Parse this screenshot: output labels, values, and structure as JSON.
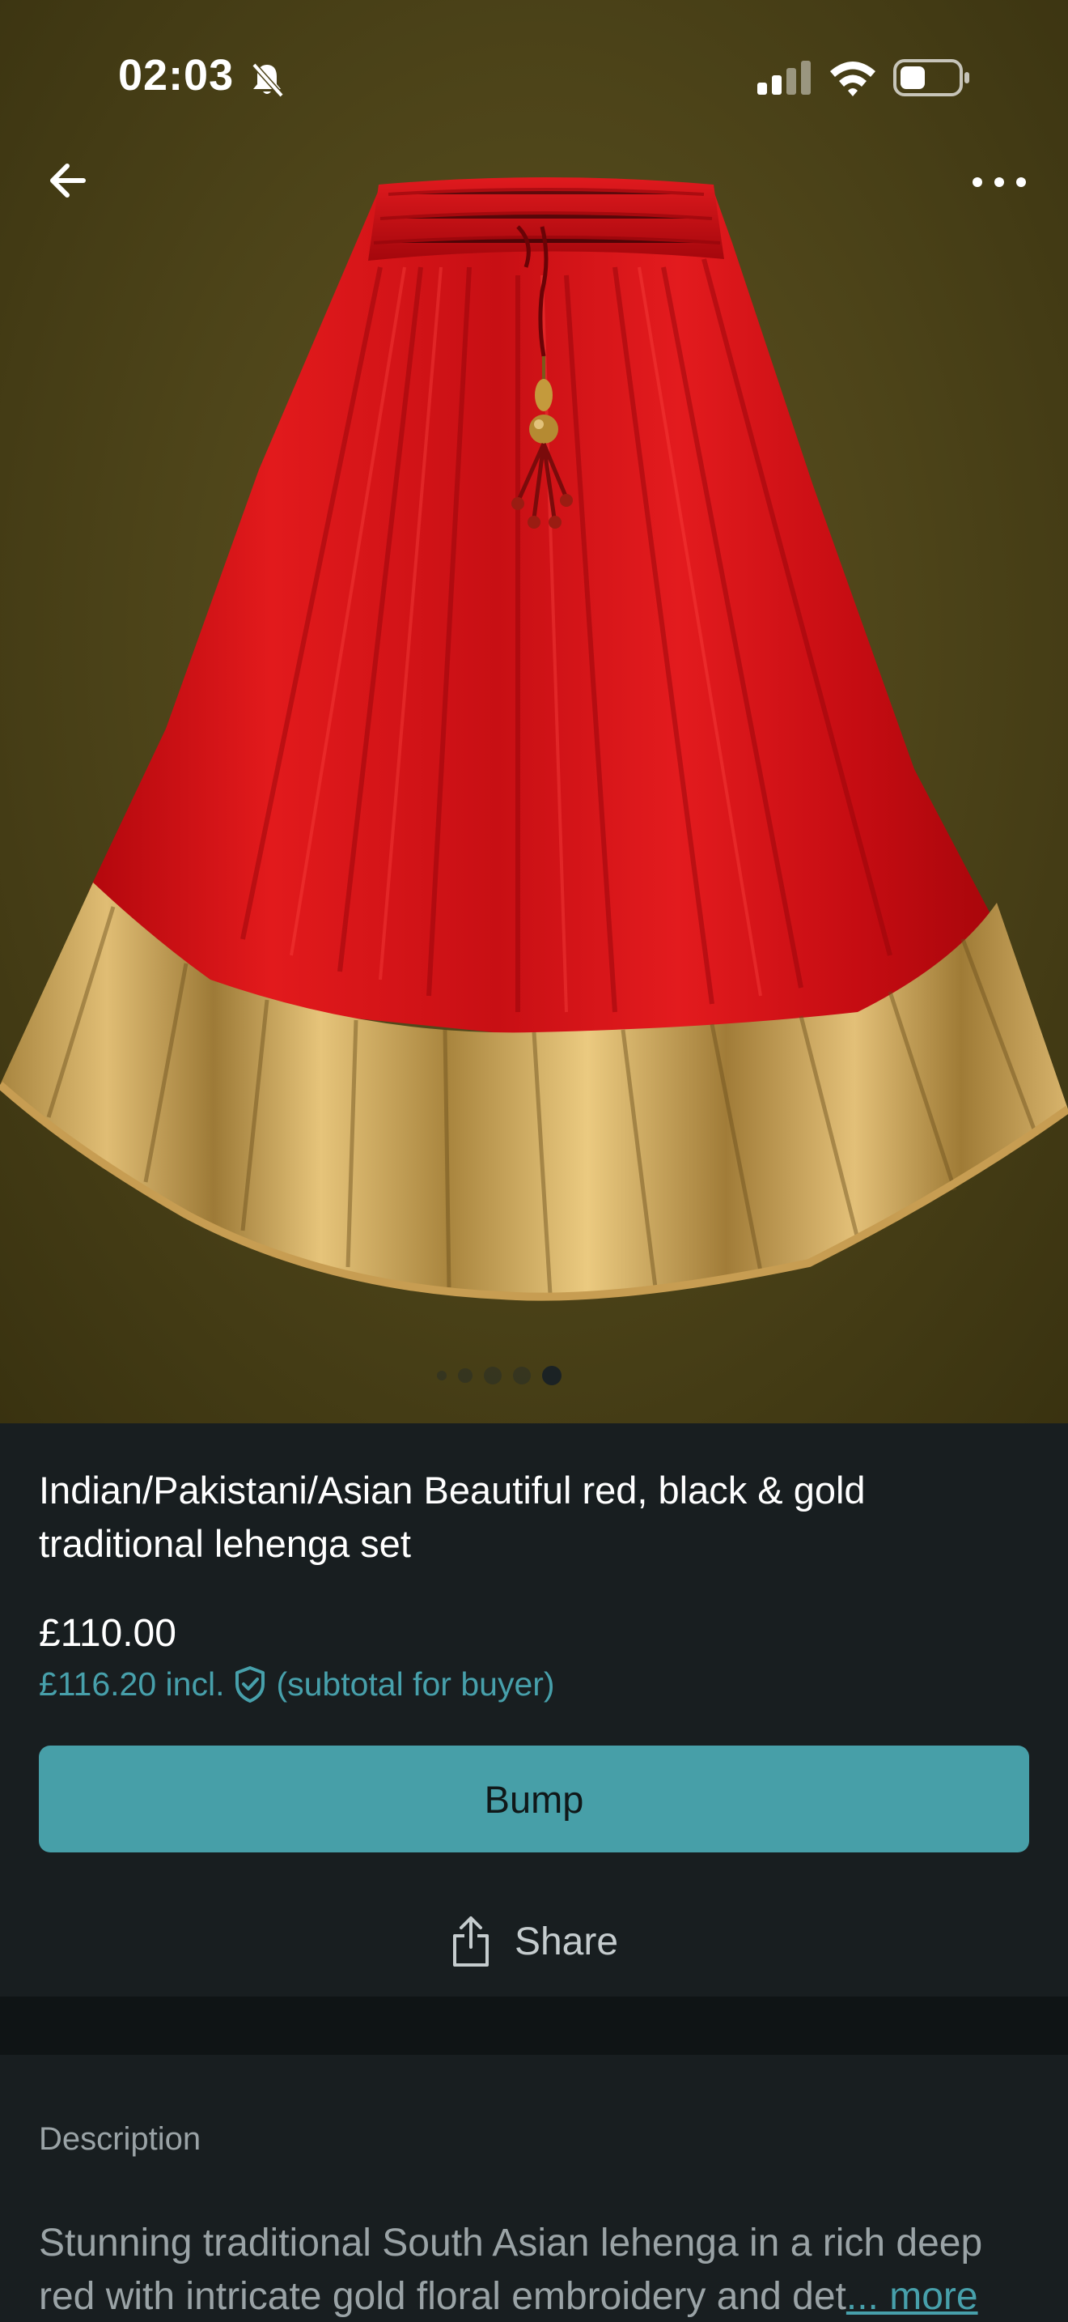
{
  "status_bar": {
    "time": "02:03",
    "icons": [
      "bell-slash-icon",
      "signal-icon",
      "wifi-icon",
      "battery-icon"
    ]
  },
  "nav": {
    "back_icon": "arrow-left-icon",
    "more_icon": "ellipsis-icon"
  },
  "gallery": {
    "image_count": 5,
    "active_index": 4
  },
  "listing": {
    "title": "Indian/Pakistani/Asian Beautiful red, black & gold traditional lehenga set",
    "price": "£110.00",
    "price_incl": "£116.20 incl.",
    "buyer_note": "(subtotal for buyer)"
  },
  "actions": {
    "bump_label": "Bump",
    "share_label": "Share"
  },
  "description": {
    "label": "Description",
    "text": "Stunning traditional South Asian lehenga in a rich deep red with intricate gold floral embroidery and det",
    "more_label": "... more"
  },
  "colors": {
    "accent": "#479fa8",
    "background": "#181e20",
    "separator": "#0f1415",
    "text_primary": "#ffffff",
    "text_muted": "#9aa3a6"
  }
}
